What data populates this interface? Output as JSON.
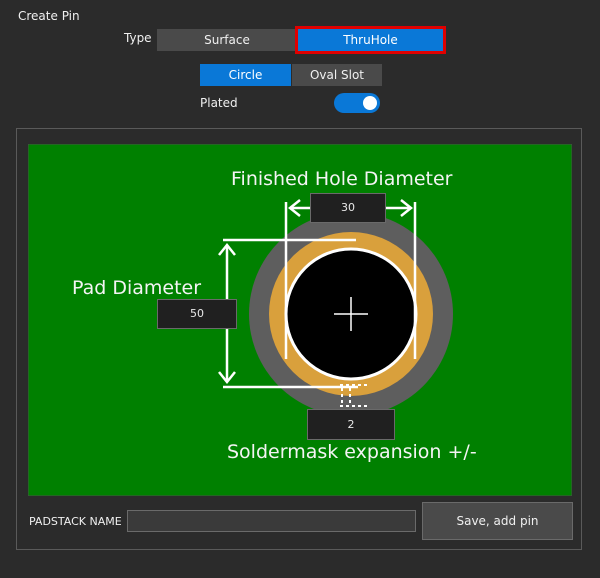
{
  "header": {
    "title": "Create Pin"
  },
  "type_selector": {
    "label": "Type",
    "options": [
      "Surface",
      "ThruHole"
    ],
    "selected": "ThruHole"
  },
  "shape_selector": {
    "options": [
      "Circle",
      "Oval Slot"
    ],
    "selected": "Circle"
  },
  "plated": {
    "label": "Plated",
    "value": true
  },
  "diagram": {
    "finished_hole_label": "Finished Hole Diameter",
    "finished_hole_value": "30",
    "pad_diameter_label": "Pad Diameter",
    "pad_diameter_value": "50",
    "soldermask_label": "Soldermask expansion +/-",
    "soldermask_value": "2"
  },
  "footer": {
    "padstack_label": "PADSTACK NAME",
    "padstack_value": "",
    "save_label": "Save, add pin"
  },
  "colors": {
    "accent": "#0a78d7",
    "highlight": "#e00000",
    "board": "#008000",
    "pad": "#d9a03c",
    "mask": "#5e5e5e"
  }
}
